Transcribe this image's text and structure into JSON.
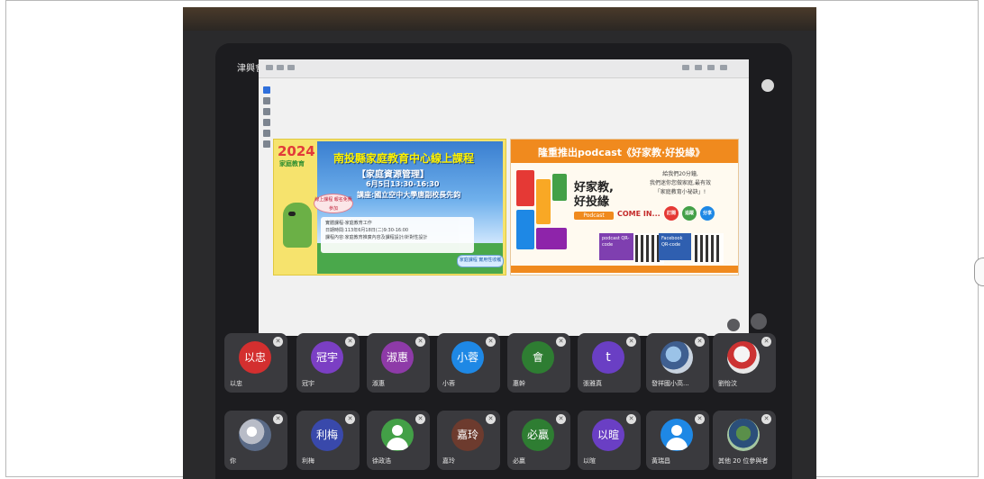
{
  "window": {
    "title": "津興會議室在線會議進行中"
  },
  "slide_left": {
    "year": "2024",
    "year_sub": "家庭教育",
    "title": "南投縣家庭教育中心線上課程",
    "subtitle": "【家庭資源管理】",
    "time": "6月5日13:30-16:30",
    "speaker": "講座:國立空中大學唐副校長先鈞",
    "badge": "線上課程 報名免費參加",
    "notice_line1": "實體課程-家庭教育工作",
    "notice_line2": "日期時間:113年6月18日(二)9:30-16:00",
    "notice_line3": "課程內容:家庭教育推廣內容及課程設計/針對性設計",
    "cta": "家庭課程 實用性收穫"
  },
  "slide_right": {
    "banner": "隆重推出podcast《好家教·好投緣》",
    "big_title_1": "好家教,",
    "big_title_2": "好投緣",
    "podcast_tag": "Podcast",
    "desc_1": "給我們20分鐘,",
    "desc_2": "我們迷你您做家庭,最有效",
    "desc_3": "「家庭教育小祕訣」!",
    "come_in": "COME IN...",
    "dots": [
      "訂閱",
      "追蹤",
      "分享"
    ],
    "podcast_box": "podcast QR-code",
    "facebook_box": "Facebook QR-code"
  },
  "participants": [
    {
      "avatar": "以忠",
      "name": "以忠",
      "color": "#d32f2f"
    },
    {
      "avatar": "冠宇",
      "name": "冠宇",
      "color": "#7b3fc4"
    },
    {
      "avatar": "淑惠",
      "name": "淑惠",
      "color": "#8e3aa8"
    },
    {
      "avatar": "小蓉",
      "name": "小蓉",
      "color": "#1e88e5"
    },
    {
      "avatar": "會",
      "name": "惠幹",
      "color": "#2e7d32"
    },
    {
      "avatar": "t",
      "name": "張雅真",
      "color": "#6a3fc4"
    },
    {
      "avatar": "",
      "name": "發祥國小高...",
      "color": "#ffffff"
    },
    {
      "avatar": "",
      "name": "劉怡汶",
      "color": "#ffffff"
    },
    {
      "avatar": "",
      "name": "你",
      "color": "#ffffff"
    },
    {
      "avatar": "利梅",
      "name": "利梅",
      "color": "#3949ab"
    },
    {
      "avatar": "",
      "name": "徐政浩",
      "color": "#43a047"
    },
    {
      "avatar": "嘉玲",
      "name": "嘉玲",
      "color": "#6d3b2e"
    },
    {
      "avatar": "必贏",
      "name": "必贏",
      "color": "#2e7d32"
    },
    {
      "avatar": "以暄",
      "name": "以暄",
      "color": "#6a3fc4"
    },
    {
      "avatar": "",
      "name": "黃瑞昌",
      "color": "#1e88e5"
    },
    {
      "avatar": "",
      "name": "其他 20 位參與者",
      "color": "#ffffff"
    }
  ],
  "icons": {
    "mute": "mic-off-icon",
    "fullscreen": "fullscreen-icon",
    "more": "more-icon"
  }
}
